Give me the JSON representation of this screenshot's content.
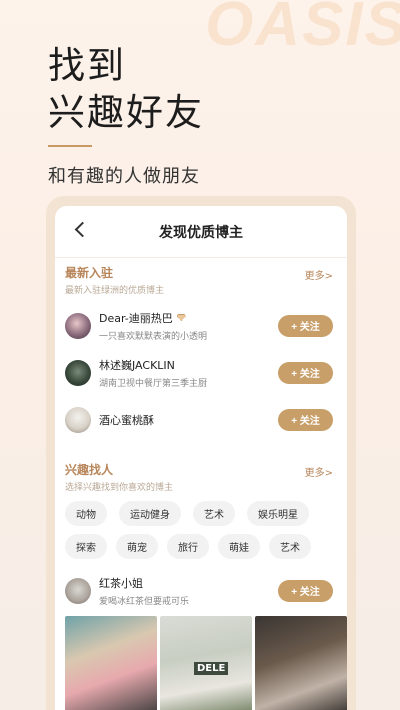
{
  "watermark": "OASIS",
  "headline": {
    "line1": "找到",
    "line2": "兴趣好友"
  },
  "subline": "和有趣的人做朋友",
  "nav": {
    "title": "发现优质博主"
  },
  "newcomers": {
    "title": "最新入驻",
    "subtitle": "最新入驻绿洲的优质博主",
    "more": "更多>",
    "items": [
      {
        "name": "Dear-迪丽热巴",
        "desc": "一只喜欢默默表演的小透明",
        "follow": "+ 关注",
        "badge": "diamond-icon"
      },
      {
        "name": "林述巍JACKLIN",
        "desc": "湖南卫视中餐厅第三季主厨",
        "follow": "+ 关注"
      },
      {
        "name": "酒心蜜桃酥",
        "desc": "",
        "follow": "+ 关注"
      }
    ]
  },
  "interests": {
    "title": "兴趣找人",
    "subtitle": "选择兴趣找到你喜欢的博主",
    "more": "更多>",
    "row1": [
      "动物",
      "运动健身",
      "艺术",
      "娱乐明星"
    ],
    "row2": [
      "探索",
      "萌宠",
      "旅行",
      "萌娃",
      "艺术"
    ]
  },
  "featured": {
    "name": "红茶小姐",
    "desc": "爱喝冰红茶但要戒可乐",
    "follow": "+ 关注",
    "photo_text": "DELE"
  },
  "colors": {
    "accent": "#c89e69",
    "section_title": "#b8865a"
  }
}
